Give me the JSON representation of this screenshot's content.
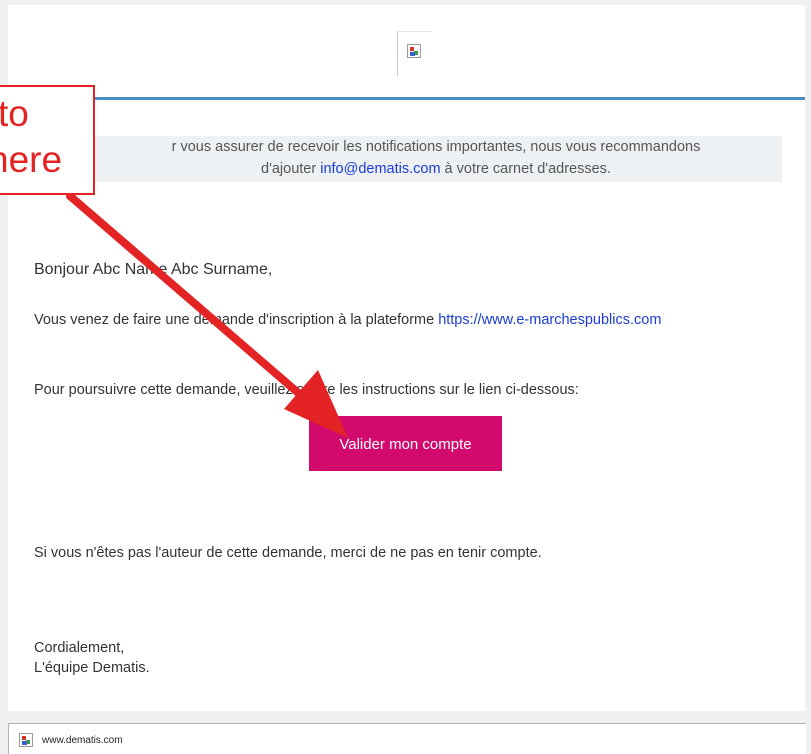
{
  "annotation": {
    "line1": "to",
    "line2": "here",
    "color": "#e42424"
  },
  "email": {
    "logo_icon": "broken-image-icon",
    "notice": {
      "prefix": "r vous assurer de recevoir les notifications importantes, nous vous recommandons",
      "line2_before": "d'ajouter ",
      "email_link": "info@dematis.com",
      "line2_after": " à votre carnet d'adresses."
    },
    "greeting": "Bonjour Abc Name Abc Surname,",
    "intro_text": "Vous venez de faire une demande d'inscription à la plateforme ",
    "intro_link": "https://www.e-marchespublics.com",
    "continue_text": "Pour poursuivre cette demande, veuillez suivre les instructions sur le lien ci-dessous:",
    "cta_label": "Valider mon compte",
    "disclaimer": "Si vous n'êtes pas l'auteur de cette demande, merci de ne pas en tenir compte.",
    "signoff_line1": "Cordialement,",
    "signoff_line2": "L'équipe Dematis."
  },
  "footer": {
    "icon": "broken-image-icon",
    "label": "www.dematis.com"
  },
  "colors": {
    "accent_rule": "#4a8dc4",
    "cta_background": "#d20a6e",
    "link": "#1a3cd6"
  }
}
